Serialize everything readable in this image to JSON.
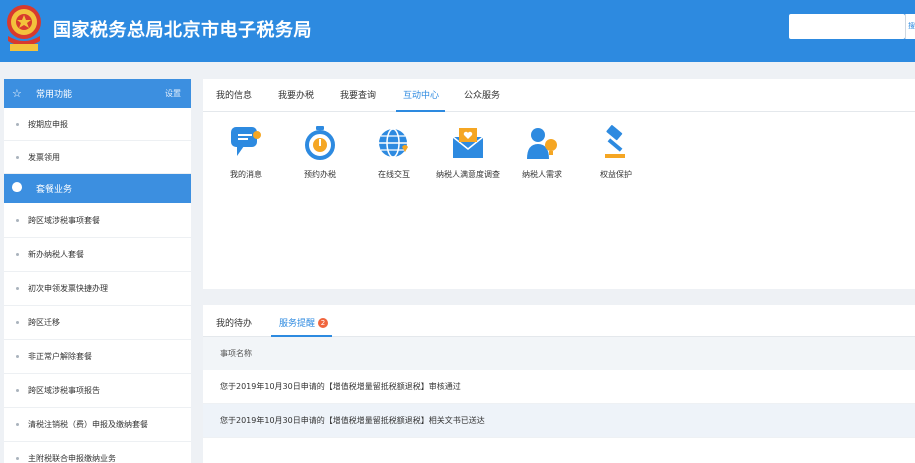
{
  "header": {
    "title": "国家税务总局北京市电子税务局",
    "search_placeholder": "",
    "search_button": "搜"
  },
  "colors": {
    "brand_blue": "#2d8ae0",
    "sidebar_blue": "#3c8fe0",
    "badge_orange": "#f0643c"
  },
  "sidebar": {
    "common": {
      "label": "常用功能",
      "settings": "设置",
      "icon": "star-icon"
    },
    "common_items": [
      "按期应申报",
      "发票领用"
    ],
    "package": {
      "label": "套餐业务",
      "icon": "shield-icon"
    },
    "package_items": [
      "跨区域涉税事项套餐",
      "新办纳税人套餐",
      "初次申领发票快捷办理",
      "跨区迁移",
      "非正常户解除套餐",
      "跨区域涉税事项报告",
      "清税注销税（费）申报及缴纳套餐",
      "主附税联合申报缴纳业务"
    ]
  },
  "main": {
    "tabs": [
      "我的信息",
      "我要办税",
      "我要查询",
      "互动中心",
      "公众服务"
    ],
    "active_tab": "互动中心",
    "services": [
      {
        "label": "我的消息",
        "icon": "message-icon"
      },
      {
        "label": "预约办税",
        "icon": "stopwatch-icon"
      },
      {
        "label": "在线交互",
        "icon": "globe-icon"
      },
      {
        "label": "纳税人满意度调查",
        "icon": "survey-envelope-icon"
      },
      {
        "label": "纳税人需求",
        "icon": "person-idea-icon"
      },
      {
        "label": "权益保护",
        "icon": "gavel-icon"
      }
    ]
  },
  "tasks": {
    "tabs": [
      "我的待办",
      "服务提醒"
    ],
    "active_tab": "服务提醒",
    "badge": "2",
    "column": "事项名称",
    "rows": [
      "您于2019年10月30日申请的【增值税增量留抵税额退税】审核通过",
      "您于2019年10月30日申请的【增值税增量留抵税额退税】相关文书已送达"
    ]
  }
}
